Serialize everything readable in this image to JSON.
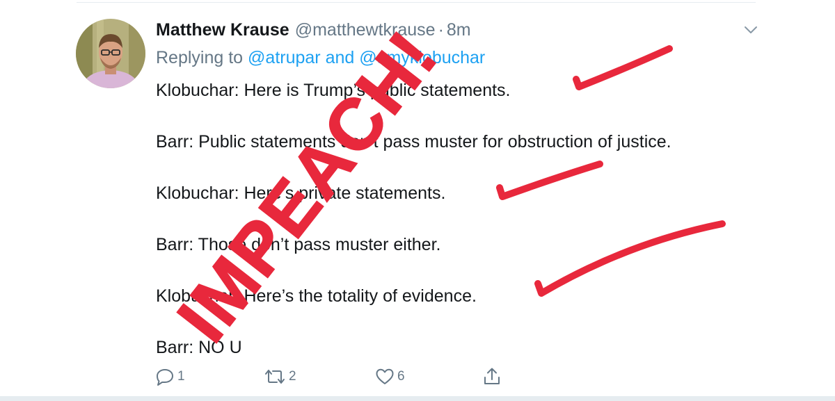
{
  "tweet": {
    "display_name": "Matthew Krause",
    "handle": "@matthewtkrause",
    "separator": "·",
    "time": "8m",
    "replying_prefix": "Replying to",
    "reply_mention_1": "@atrupar",
    "reply_conjunction": "and",
    "reply_mention_2": "@amyklobuchar",
    "lines": [
      "Klobuchar: Here is Trump’s public statements.",
      "Barr: Public statements don’t pass muster for obstruction of justice.",
      "Klobuchar: Here’s private statements.",
      "Barr: Those don’t pass muster either.",
      "Klobuchar: Here’s the totality of evidence.",
      "Barr: NO U"
    ],
    "reply_count": "1",
    "retweet_count": "2",
    "like_count": "6"
  },
  "annotation": {
    "text": "IMPEACH!",
    "color": "#e8283c"
  },
  "icons": {
    "avatar": "avatar-photo",
    "chevron": "chevron-down-icon",
    "reply": "reply-icon",
    "retweet": "retweet-icon",
    "like": "heart-icon",
    "share": "share-icon"
  }
}
